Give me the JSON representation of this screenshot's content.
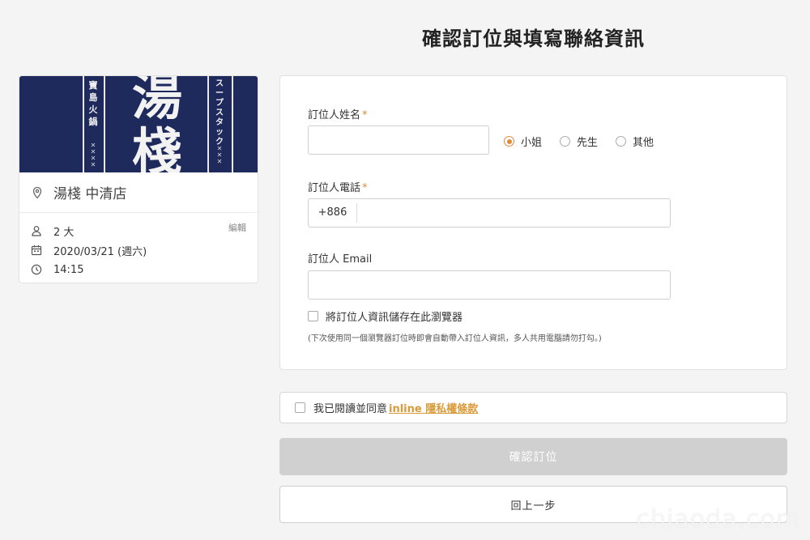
{
  "page": {
    "title": "確認訂位與填寫聯絡資訊"
  },
  "restaurant": {
    "banner": {
      "big_text": "湯棧",
      "left_vertical": "寶島火鍋",
      "right_vertical": "スープスタック"
    },
    "store_name": "湯棧 中清店",
    "edit_label": "編輯",
    "party": "2 大",
    "date": "2020/03/21 (週六)",
    "time": "14:15"
  },
  "form": {
    "name_label": "訂位人姓名",
    "required_mark": "*",
    "name_value": "",
    "salutations": [
      {
        "label": "小姐",
        "checked": true
      },
      {
        "label": "先生",
        "checked": false
      },
      {
        "label": "其他",
        "checked": false
      }
    ],
    "phone_label": "訂位人電話",
    "phone_prefix": "+886",
    "phone_value": "",
    "email_label": "訂位人 Email",
    "email_value": "",
    "save_label": "將訂位人資訊儲存在此瀏覽器",
    "save_hint": "(下次使用同一個瀏覽器訂位時即會自動帶入訂位人資訊，多人共用電腦請勿打勾。)"
  },
  "agreement": {
    "prefix": "我已閱讀並同意",
    "link": "inline 隱私權條款"
  },
  "actions": {
    "confirm_label": "確認訂位",
    "back_label": "回上一步"
  },
  "watermark": "chiaoda.com",
  "colors": {
    "accent": "#e08a3a",
    "link": "#d99a3a",
    "banner": "#1e2a5c",
    "disabled_button": "#d0d0d0"
  }
}
